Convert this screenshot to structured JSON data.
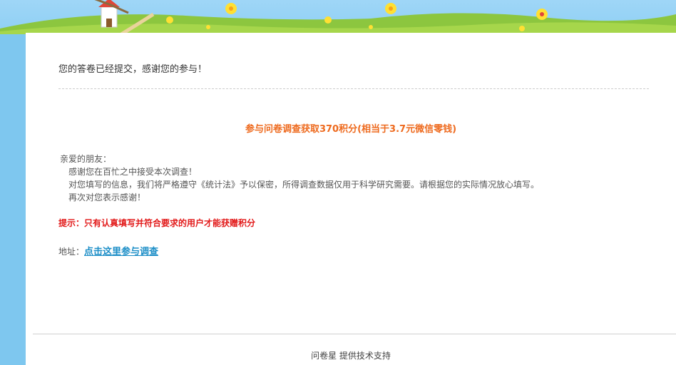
{
  "notice": {
    "submitted_text": "您的答卷已经提交，感谢您的参与！",
    "reward_text": "参与问卷调查获取370积分(相当于3.7元微信零钱)"
  },
  "letter": {
    "greeting": "亲爱的朋友：",
    "lines": [
      "感谢您在百忙之中接受本次调查！",
      "对您填写的信息，我们将严格遵守《统计法》予以保密，所得调查数据仅用于科学研究需要。请根据您的实际情况放心填写。",
      "再次对您表示感谢！"
    ]
  },
  "tip": {
    "text": "提示：只有认真填写并符合要求的用户才能获赠积分"
  },
  "address": {
    "label": "地址：",
    "link_text": "点击这里参与调查"
  },
  "footer": {
    "text": "问卷星 提供技术支持"
  }
}
